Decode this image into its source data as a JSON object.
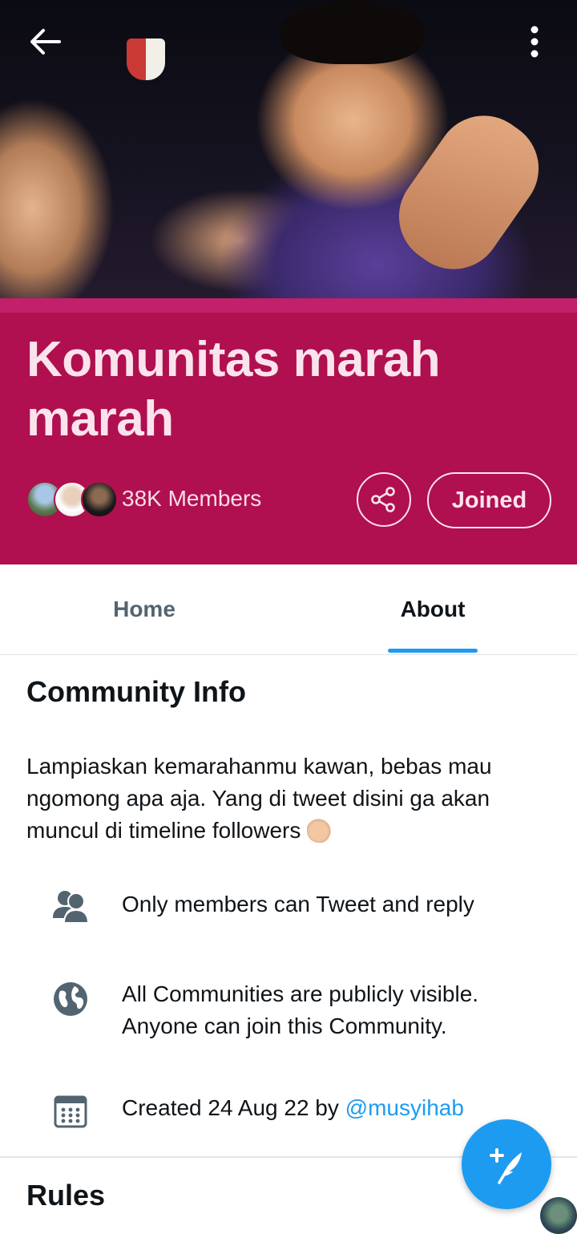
{
  "banner": {
    "back_icon": "arrow-left-icon",
    "more_icon": "vertical-ellipsis-icon"
  },
  "community": {
    "name": "Komunitas marah marah",
    "members": "38K Members",
    "share_icon": "share-icon",
    "joined_label": "Joined",
    "colors": {
      "header_bg": "#b0104f",
      "band": "#c2206a",
      "accent": "#1d9bf0"
    }
  },
  "tabs": [
    {
      "label": "Home",
      "selected": false
    },
    {
      "label": "About",
      "selected": true
    }
  ],
  "about": {
    "community_info_title": "Community Info",
    "description": "Lampiaskan kemarahanmu kawan, bebas mau ngomong apa aja. Yang di tweet disini ga akan muncul di timeline followers",
    "rows": [
      {
        "icon": "people-icon",
        "text": "Only members can Tweet and reply"
      },
      {
        "icon": "globe-icon",
        "text": "All Communities are publicly visible. Anyone can join this Community."
      },
      {
        "icon": "calendar-icon",
        "text_prefix": "Created 24 Aug 22 by ",
        "link": "@musyihab"
      }
    ],
    "rules_title": "Rules"
  },
  "fab": {
    "icon": "compose-tweet-icon"
  }
}
